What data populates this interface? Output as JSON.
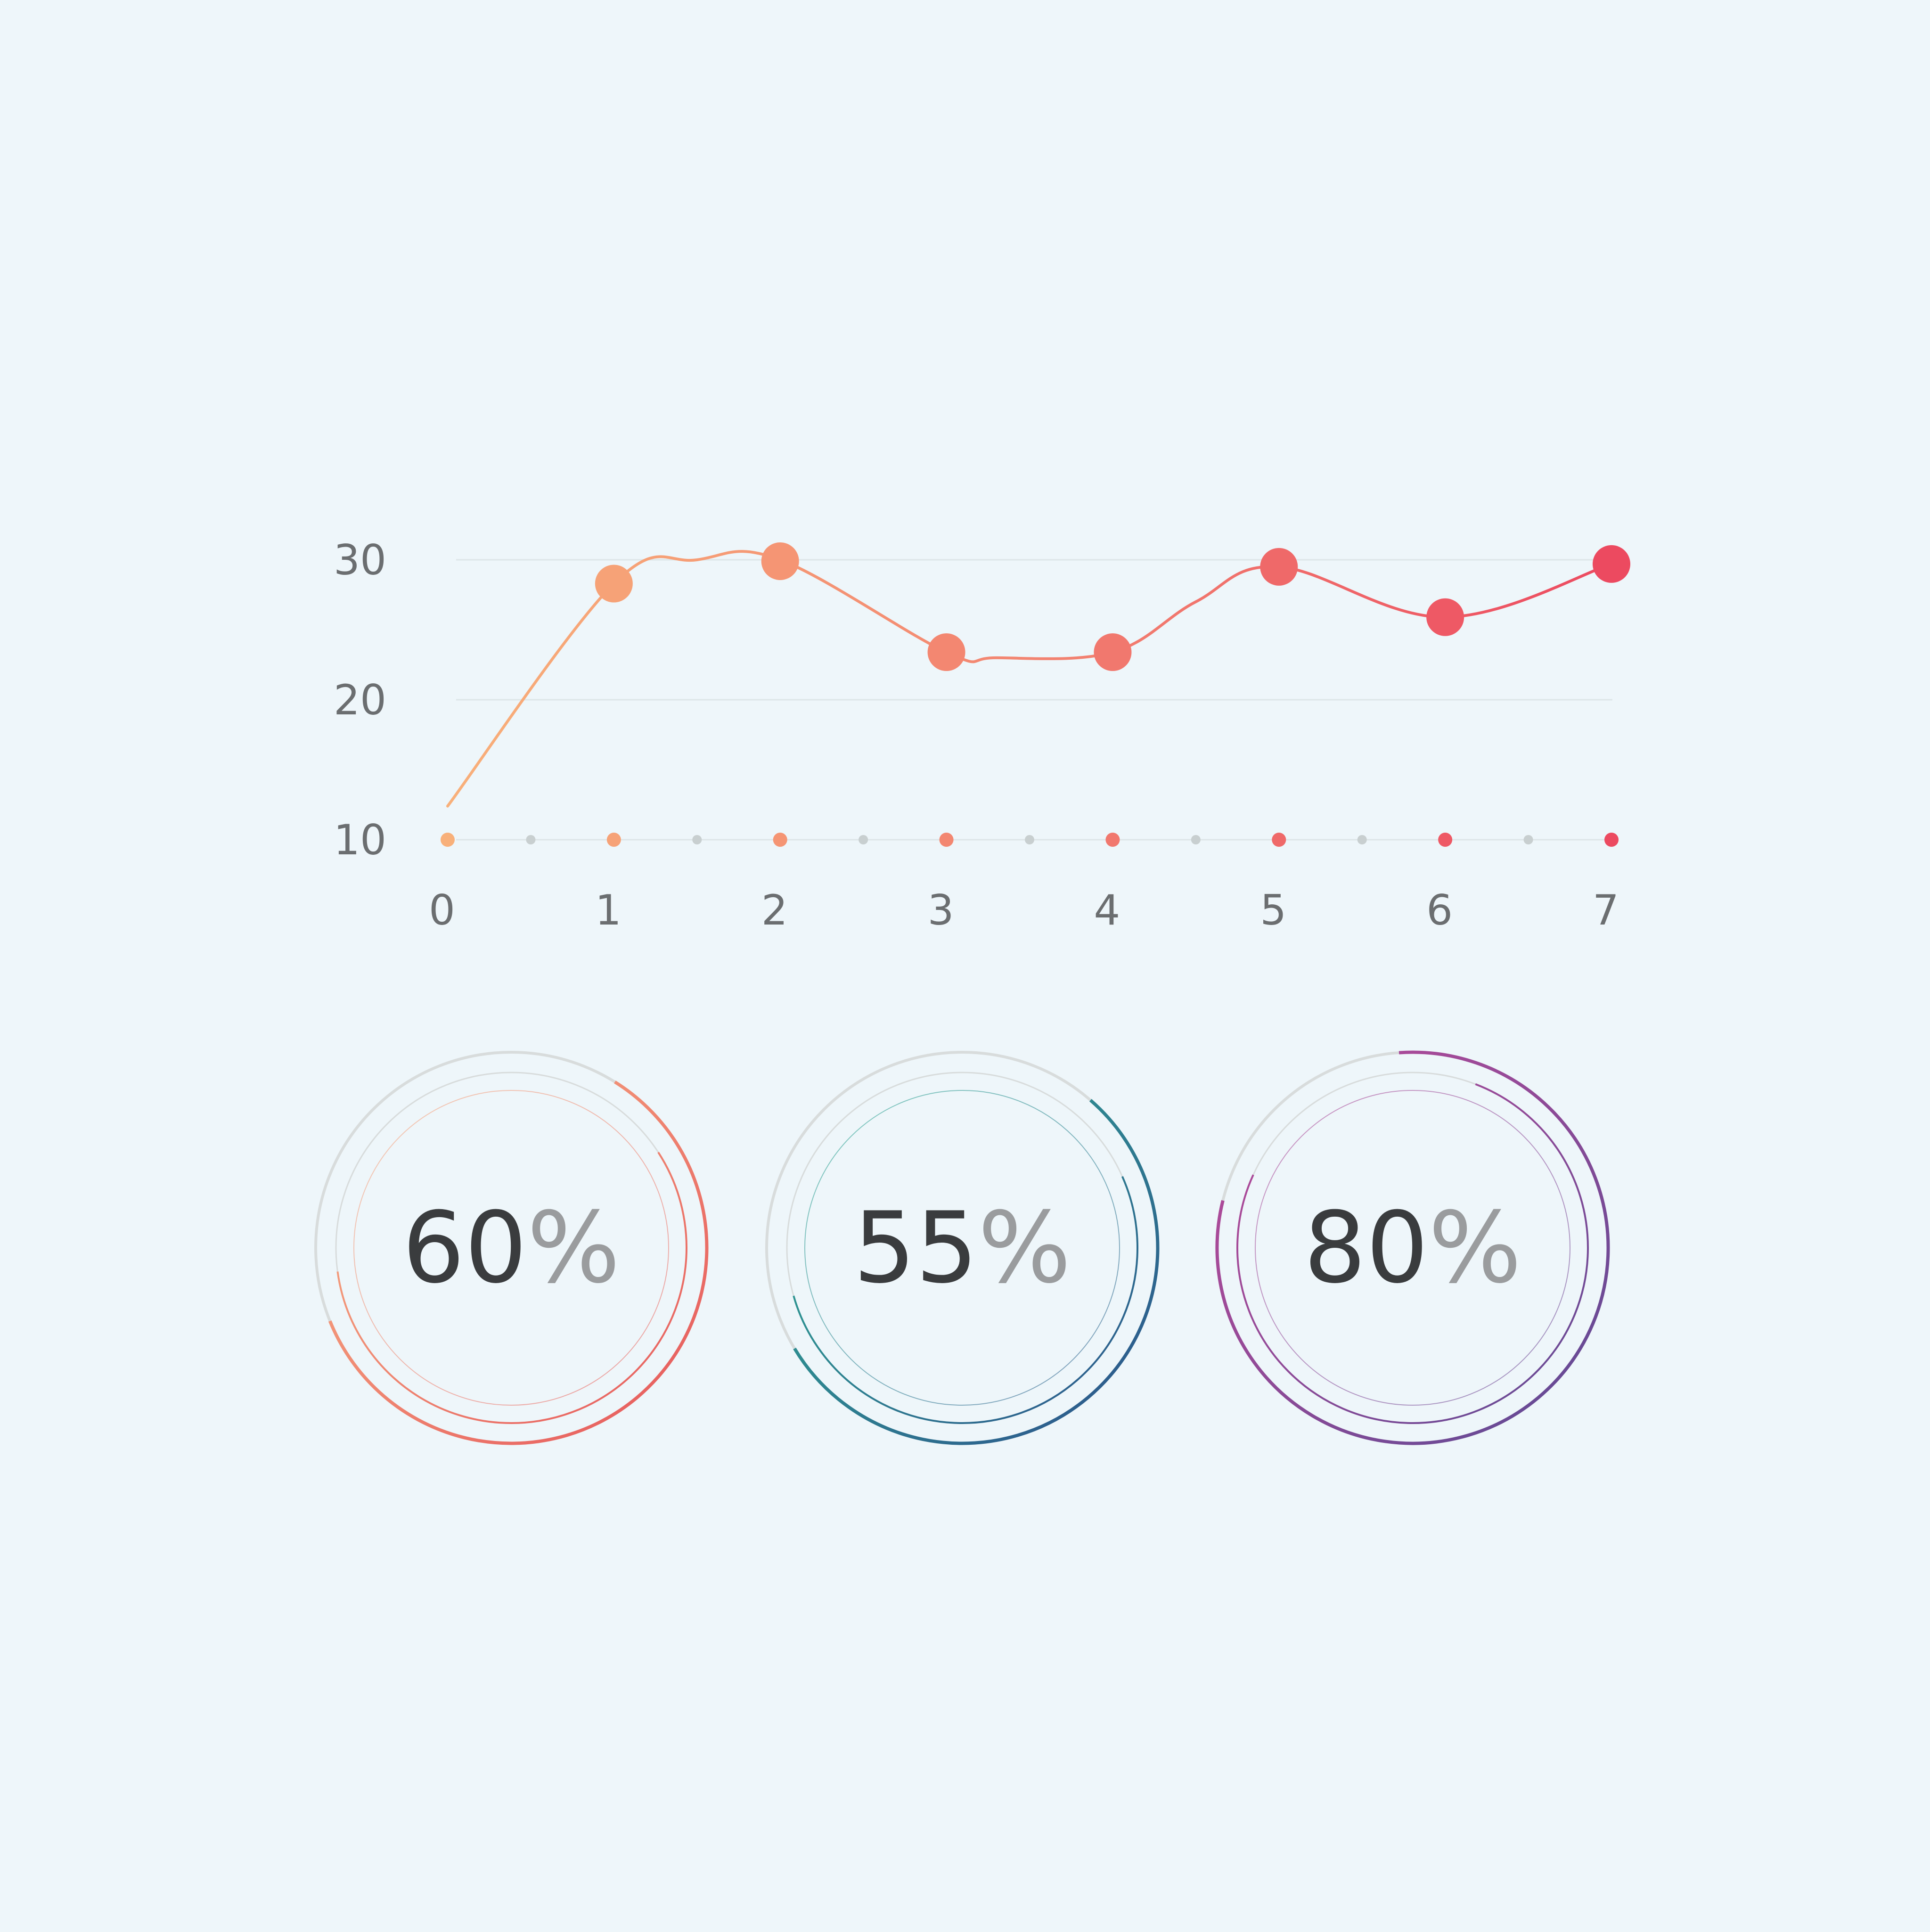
{
  "chart_data": [
    {
      "type": "line",
      "x": [
        0,
        0.5,
        1,
        1.5,
        2,
        2.5,
        3,
        3.5,
        4,
        4.5,
        5,
        5.5,
        6,
        6.5,
        7
      ],
      "x_ticks": [
        "0",
        "1",
        "2",
        "3",
        "4",
        "5",
        "6",
        "7"
      ],
      "y_ticks": [
        "10",
        "20",
        "30"
      ],
      "ylim": [
        10,
        30
      ],
      "xlim": [
        0,
        7
      ],
      "series": [
        {
          "x": [
            0,
            1,
            1.5,
            2,
            3,
            3.3,
            4,
            4.5,
            5,
            6,
            7
          ],
          "y": [
            12.4,
            28.3,
            30,
            30,
            23.4,
            23,
            23.4,
            27,
            29.5,
            25.9,
            29.7
          ]
        }
      ],
      "markers": {
        "x": [
          1,
          2,
          3,
          4,
          5,
          6,
          7
        ],
        "y": [
          28.3,
          29.9,
          23.4,
          23.4,
          29.5,
          25.9,
          29.7
        ]
      },
      "colors": {
        "gradient_start": "#f8b07a",
        "gradient_mid": "#f28070",
        "gradient_end": "#ec4a60",
        "grid": "#dde6e8",
        "minor_dot": "#c8cfd0"
      },
      "grid": true
    },
    {
      "type": "gauge",
      "gauges": [
        {
          "value": "60",
          "unit": "%",
          "percent": 60,
          "colors": [
            "#f9b889",
            "#e5555a"
          ]
        },
        {
          "value": "55",
          "unit": "%",
          "percent": 55,
          "colors": [
            "#2eb894",
            "#2d4f8c"
          ]
        },
        {
          "value": "80",
          "unit": "%",
          "percent": 80,
          "colors": [
            "#c04a9a",
            "#5a4a94"
          ]
        }
      ],
      "track_color": "#d8dcdc"
    }
  ]
}
